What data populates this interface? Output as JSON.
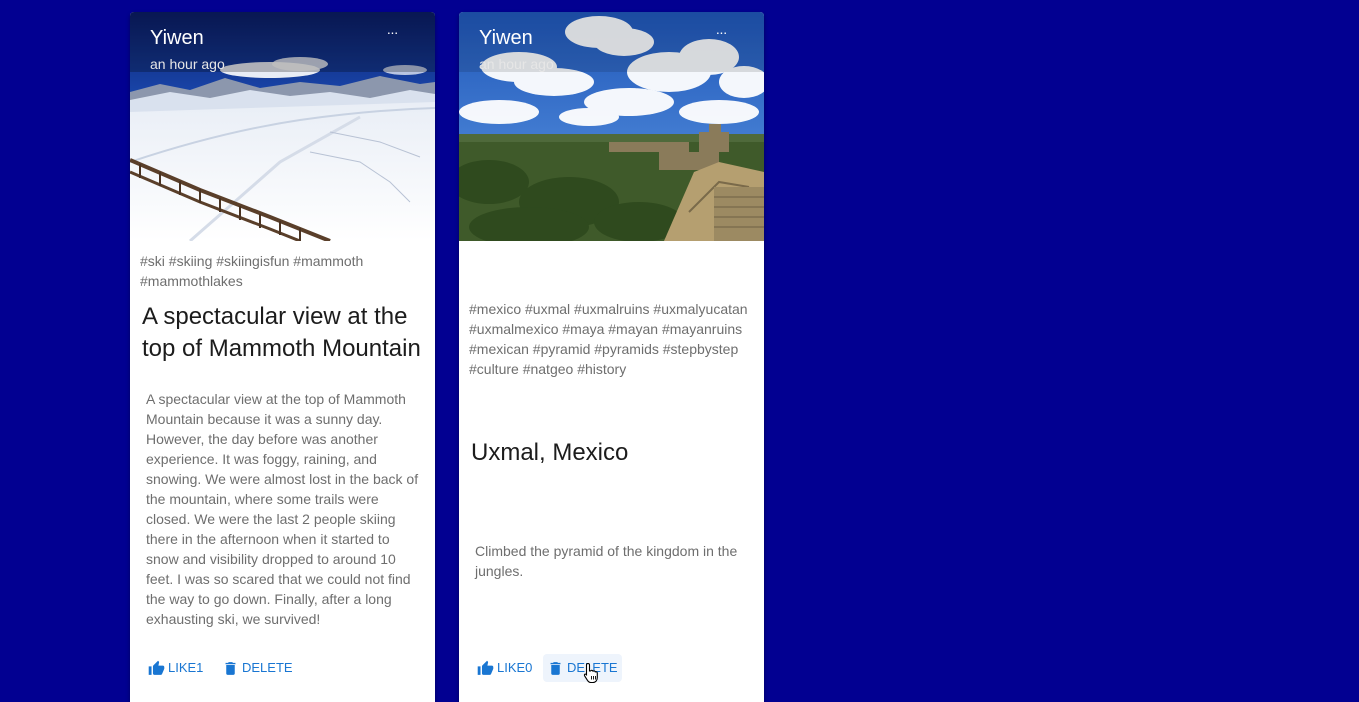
{
  "posts": [
    {
      "author": "Yiwen",
      "time": "an hour ago",
      "more_label": "···",
      "tags": "#ski #skiing #skiingisfun #mammoth #mammothlakes",
      "title": "A spectacular view at the top of Mammoth Mountain",
      "message": "A spectacular view at the top of Mammoth Mountain because it was a sunny day. However, the day before was another experience. It was foggy, raining, and snowing. We were almost lost in the back of the mountain, where some trails were closed. We were the last 2 people skiing there in the afternoon when it started to snow and visibility dropped to around 10 feet. I was so scared that we could not find the way to go down. Finally, after a long exhausting ski, we survived!",
      "like_label": "LIKE1",
      "delete_label": "DELETE",
      "image_subject": "snowy-mountain-ski-slope"
    },
    {
      "author": "Yiwen",
      "time": "an hour ago",
      "more_label": "···",
      "tags": "#mexico #uxmal #uxmalruins #uxmalyucatan #uxmalmexico #maya #mayan #mayanruins #mexican #pyramid #pyramids #stepbystep #culture #natgeo #history",
      "title": "Uxmal, Mexico",
      "message": "Climbed the pyramid of the kingdom in the jungles.",
      "like_label": "LIKE0",
      "delete_label": "DELETE",
      "image_subject": "jungle-ruins-with-clouds"
    }
  ],
  "colors": {
    "background": "#020091",
    "accent": "#1976d2",
    "card": "#ffffff"
  },
  "icons": [
    "more-icon",
    "thumb-up-icon",
    "delete-icon",
    "pointer-cursor-icon"
  ]
}
